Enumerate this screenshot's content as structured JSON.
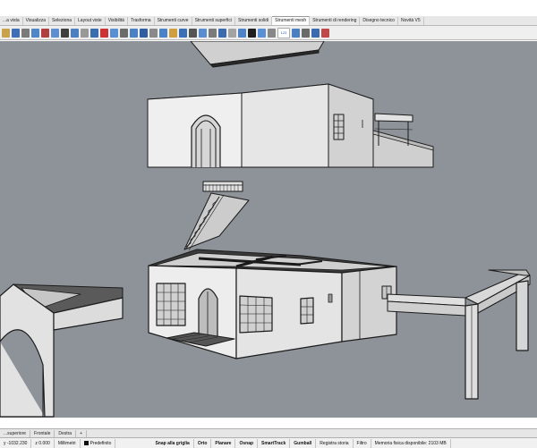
{
  "tabs": [
    {
      "label": "...a vista"
    },
    {
      "label": "Visualizza"
    },
    {
      "label": "Seleziona"
    },
    {
      "label": "Layout viste"
    },
    {
      "label": "Visibilità"
    },
    {
      "label": "Trasforma"
    },
    {
      "label": "Strumenti curve"
    },
    {
      "label": "Strumenti superfici"
    },
    {
      "label": "Strumenti solidi"
    },
    {
      "label": "Strumenti mesh"
    },
    {
      "label": "Strumenti di rendering"
    },
    {
      "label": "Disegno tecnico"
    },
    {
      "label": "Novità V5"
    }
  ],
  "active_tab": 9,
  "toolbar_badge": "123",
  "viewport_tabs": [
    {
      "label": "...superiore"
    },
    {
      "label": "Frontale"
    },
    {
      "label": "Destra"
    }
  ],
  "viewport_tab_add": "+",
  "status": {
    "coords_y": "y -1032.230",
    "coords_z": "z 0.000",
    "units": "Millimetri",
    "layer": "Predefinito",
    "snap": "Snap alla griglia",
    "orto": "Orto",
    "planare": "Planare",
    "osnap": "Osnap",
    "smarttrack": "SmartTrack",
    "gumball": "Gumball",
    "history": "Registra storia",
    "filter": "Filtro",
    "memory": "Memoria fisica disponibile: 2103 MB"
  },
  "colors": {
    "viewport_bg": "#8e9399",
    "wall_front": "#efefef",
    "wall_side": "#d4d4d4",
    "edge": "#1b1b1b",
    "toolbar_bg": "#efefef"
  }
}
